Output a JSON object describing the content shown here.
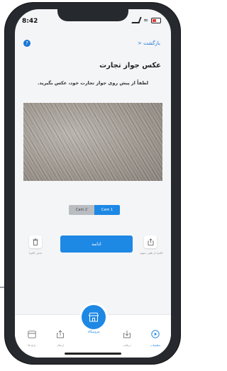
{
  "status": {
    "time": "8:42"
  },
  "nav": {
    "back_label": "بازگشت <"
  },
  "page": {
    "title": "عکس جواز تجارت",
    "instruction": "لطفاً از پیش روی جواز تجارت خود، عکس بگیرید."
  },
  "camera_toggle": {
    "options": [
      "Cam 2",
      "Cam 1"
    ],
    "selected": "Cam 1"
  },
  "actions": {
    "continue_label": "ادامه",
    "delete_label": "حذف کامرا",
    "upload_label": "کامرا از تلفن دعوید"
  },
  "tabbar": {
    "items": [
      "رایج ها",
      "ارسال",
      "دریافت",
      "تنظیمات"
    ],
    "center_label": "فروشگاه",
    "active": "تنظیمات"
  },
  "colors": {
    "accent": "#1e88e5",
    "screen_bg": "#f4f5f7"
  }
}
